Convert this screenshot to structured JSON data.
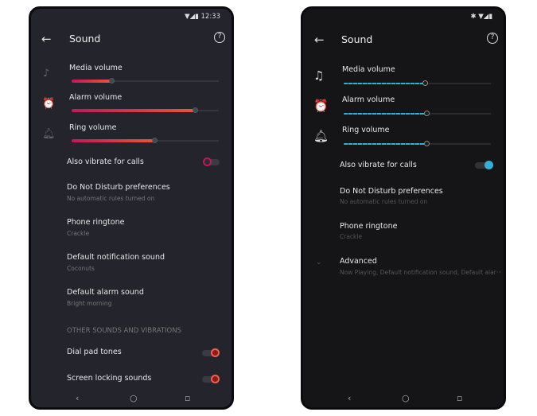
{
  "left": {
    "status_time": "12:33",
    "title": "Sound",
    "sliders": [
      {
        "label": "Media volume",
        "level": 0.27
      },
      {
        "label": "Alarm volume",
        "level": 0.84
      },
      {
        "label": "Ring volume",
        "level": 0.56
      }
    ],
    "vibrate": {
      "label": "Also vibrate for calls",
      "on": false
    },
    "items": [
      {
        "title": "Do Not Disturb preferences",
        "sub": "No automatic rules turned on"
      },
      {
        "title": "Phone ringtone",
        "sub": "Crackle"
      },
      {
        "title": "Default notification sound",
        "sub": "Coconuts"
      },
      {
        "title": "Default alarm sound",
        "sub": "Bright morning"
      }
    ],
    "section_header": "OTHER SOUNDS AND VIBRATIONS",
    "toggles": [
      {
        "label": "Dial pad tones",
        "on": true
      },
      {
        "label": "Screen locking sounds",
        "on": true
      }
    ],
    "accent": "#e8553a"
  },
  "right": {
    "title": "Sound",
    "sliders": [
      {
        "label": "Media volume",
        "level": 0.55
      },
      {
        "label": "Alarm volume",
        "level": 0.56
      },
      {
        "label": "Ring volume",
        "level": 0.56
      }
    ],
    "vibrate": {
      "label": "Also vibrate for calls",
      "on": true
    },
    "items": [
      {
        "title": "Do Not Disturb preferences",
        "sub": "No automatic rules turned on"
      },
      {
        "title": "Phone ringtone",
        "sub": "Crackle"
      },
      {
        "title": "Advanced",
        "sub": "Now Playing, Default notification sound, Default alar···"
      }
    ],
    "accent": "#2fb2d6"
  },
  "nav": {
    "back": "‹",
    "home": "○",
    "recents": "▫"
  }
}
